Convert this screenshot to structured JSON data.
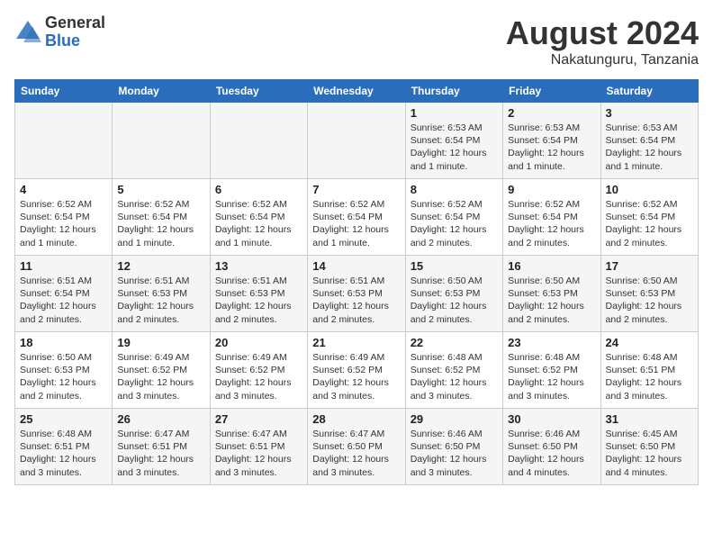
{
  "logo": {
    "general": "General",
    "blue": "Blue"
  },
  "title": {
    "month_year": "August 2024",
    "location": "Nakatunguru, Tanzania"
  },
  "headers": [
    "Sunday",
    "Monday",
    "Tuesday",
    "Wednesday",
    "Thursday",
    "Friday",
    "Saturday"
  ],
  "weeks": [
    [
      {
        "day": "",
        "info": ""
      },
      {
        "day": "",
        "info": ""
      },
      {
        "day": "",
        "info": ""
      },
      {
        "day": "",
        "info": ""
      },
      {
        "day": "1",
        "info": "Sunrise: 6:53 AM\nSunset: 6:54 PM\nDaylight: 12 hours and 1 minute."
      },
      {
        "day": "2",
        "info": "Sunrise: 6:53 AM\nSunset: 6:54 PM\nDaylight: 12 hours and 1 minute."
      },
      {
        "day": "3",
        "info": "Sunrise: 6:53 AM\nSunset: 6:54 PM\nDaylight: 12 hours and 1 minute."
      }
    ],
    [
      {
        "day": "4",
        "info": "Sunrise: 6:52 AM\nSunset: 6:54 PM\nDaylight: 12 hours and 1 minute."
      },
      {
        "day": "5",
        "info": "Sunrise: 6:52 AM\nSunset: 6:54 PM\nDaylight: 12 hours and 1 minute."
      },
      {
        "day": "6",
        "info": "Sunrise: 6:52 AM\nSunset: 6:54 PM\nDaylight: 12 hours and 1 minute."
      },
      {
        "day": "7",
        "info": "Sunrise: 6:52 AM\nSunset: 6:54 PM\nDaylight: 12 hours and 1 minute."
      },
      {
        "day": "8",
        "info": "Sunrise: 6:52 AM\nSunset: 6:54 PM\nDaylight: 12 hours and 2 minutes."
      },
      {
        "day": "9",
        "info": "Sunrise: 6:52 AM\nSunset: 6:54 PM\nDaylight: 12 hours and 2 minutes."
      },
      {
        "day": "10",
        "info": "Sunrise: 6:52 AM\nSunset: 6:54 PM\nDaylight: 12 hours and 2 minutes."
      }
    ],
    [
      {
        "day": "11",
        "info": "Sunrise: 6:51 AM\nSunset: 6:54 PM\nDaylight: 12 hours and 2 minutes."
      },
      {
        "day": "12",
        "info": "Sunrise: 6:51 AM\nSunset: 6:53 PM\nDaylight: 12 hours and 2 minutes."
      },
      {
        "day": "13",
        "info": "Sunrise: 6:51 AM\nSunset: 6:53 PM\nDaylight: 12 hours and 2 minutes."
      },
      {
        "day": "14",
        "info": "Sunrise: 6:51 AM\nSunset: 6:53 PM\nDaylight: 12 hours and 2 minutes."
      },
      {
        "day": "15",
        "info": "Sunrise: 6:50 AM\nSunset: 6:53 PM\nDaylight: 12 hours and 2 minutes."
      },
      {
        "day": "16",
        "info": "Sunrise: 6:50 AM\nSunset: 6:53 PM\nDaylight: 12 hours and 2 minutes."
      },
      {
        "day": "17",
        "info": "Sunrise: 6:50 AM\nSunset: 6:53 PM\nDaylight: 12 hours and 2 minutes."
      }
    ],
    [
      {
        "day": "18",
        "info": "Sunrise: 6:50 AM\nSunset: 6:53 PM\nDaylight: 12 hours and 2 minutes."
      },
      {
        "day": "19",
        "info": "Sunrise: 6:49 AM\nSunset: 6:52 PM\nDaylight: 12 hours and 3 minutes."
      },
      {
        "day": "20",
        "info": "Sunrise: 6:49 AM\nSunset: 6:52 PM\nDaylight: 12 hours and 3 minutes."
      },
      {
        "day": "21",
        "info": "Sunrise: 6:49 AM\nSunset: 6:52 PM\nDaylight: 12 hours and 3 minutes."
      },
      {
        "day": "22",
        "info": "Sunrise: 6:48 AM\nSunset: 6:52 PM\nDaylight: 12 hours and 3 minutes."
      },
      {
        "day": "23",
        "info": "Sunrise: 6:48 AM\nSunset: 6:52 PM\nDaylight: 12 hours and 3 minutes."
      },
      {
        "day": "24",
        "info": "Sunrise: 6:48 AM\nSunset: 6:51 PM\nDaylight: 12 hours and 3 minutes."
      }
    ],
    [
      {
        "day": "25",
        "info": "Sunrise: 6:48 AM\nSunset: 6:51 PM\nDaylight: 12 hours and 3 minutes."
      },
      {
        "day": "26",
        "info": "Sunrise: 6:47 AM\nSunset: 6:51 PM\nDaylight: 12 hours and 3 minutes."
      },
      {
        "day": "27",
        "info": "Sunrise: 6:47 AM\nSunset: 6:51 PM\nDaylight: 12 hours and 3 minutes."
      },
      {
        "day": "28",
        "info": "Sunrise: 6:47 AM\nSunset: 6:50 PM\nDaylight: 12 hours and 3 minutes."
      },
      {
        "day": "29",
        "info": "Sunrise: 6:46 AM\nSunset: 6:50 PM\nDaylight: 12 hours and 3 minutes."
      },
      {
        "day": "30",
        "info": "Sunrise: 6:46 AM\nSunset: 6:50 PM\nDaylight: 12 hours and 4 minutes."
      },
      {
        "day": "31",
        "info": "Sunrise: 6:45 AM\nSunset: 6:50 PM\nDaylight: 12 hours and 4 minutes."
      }
    ]
  ]
}
